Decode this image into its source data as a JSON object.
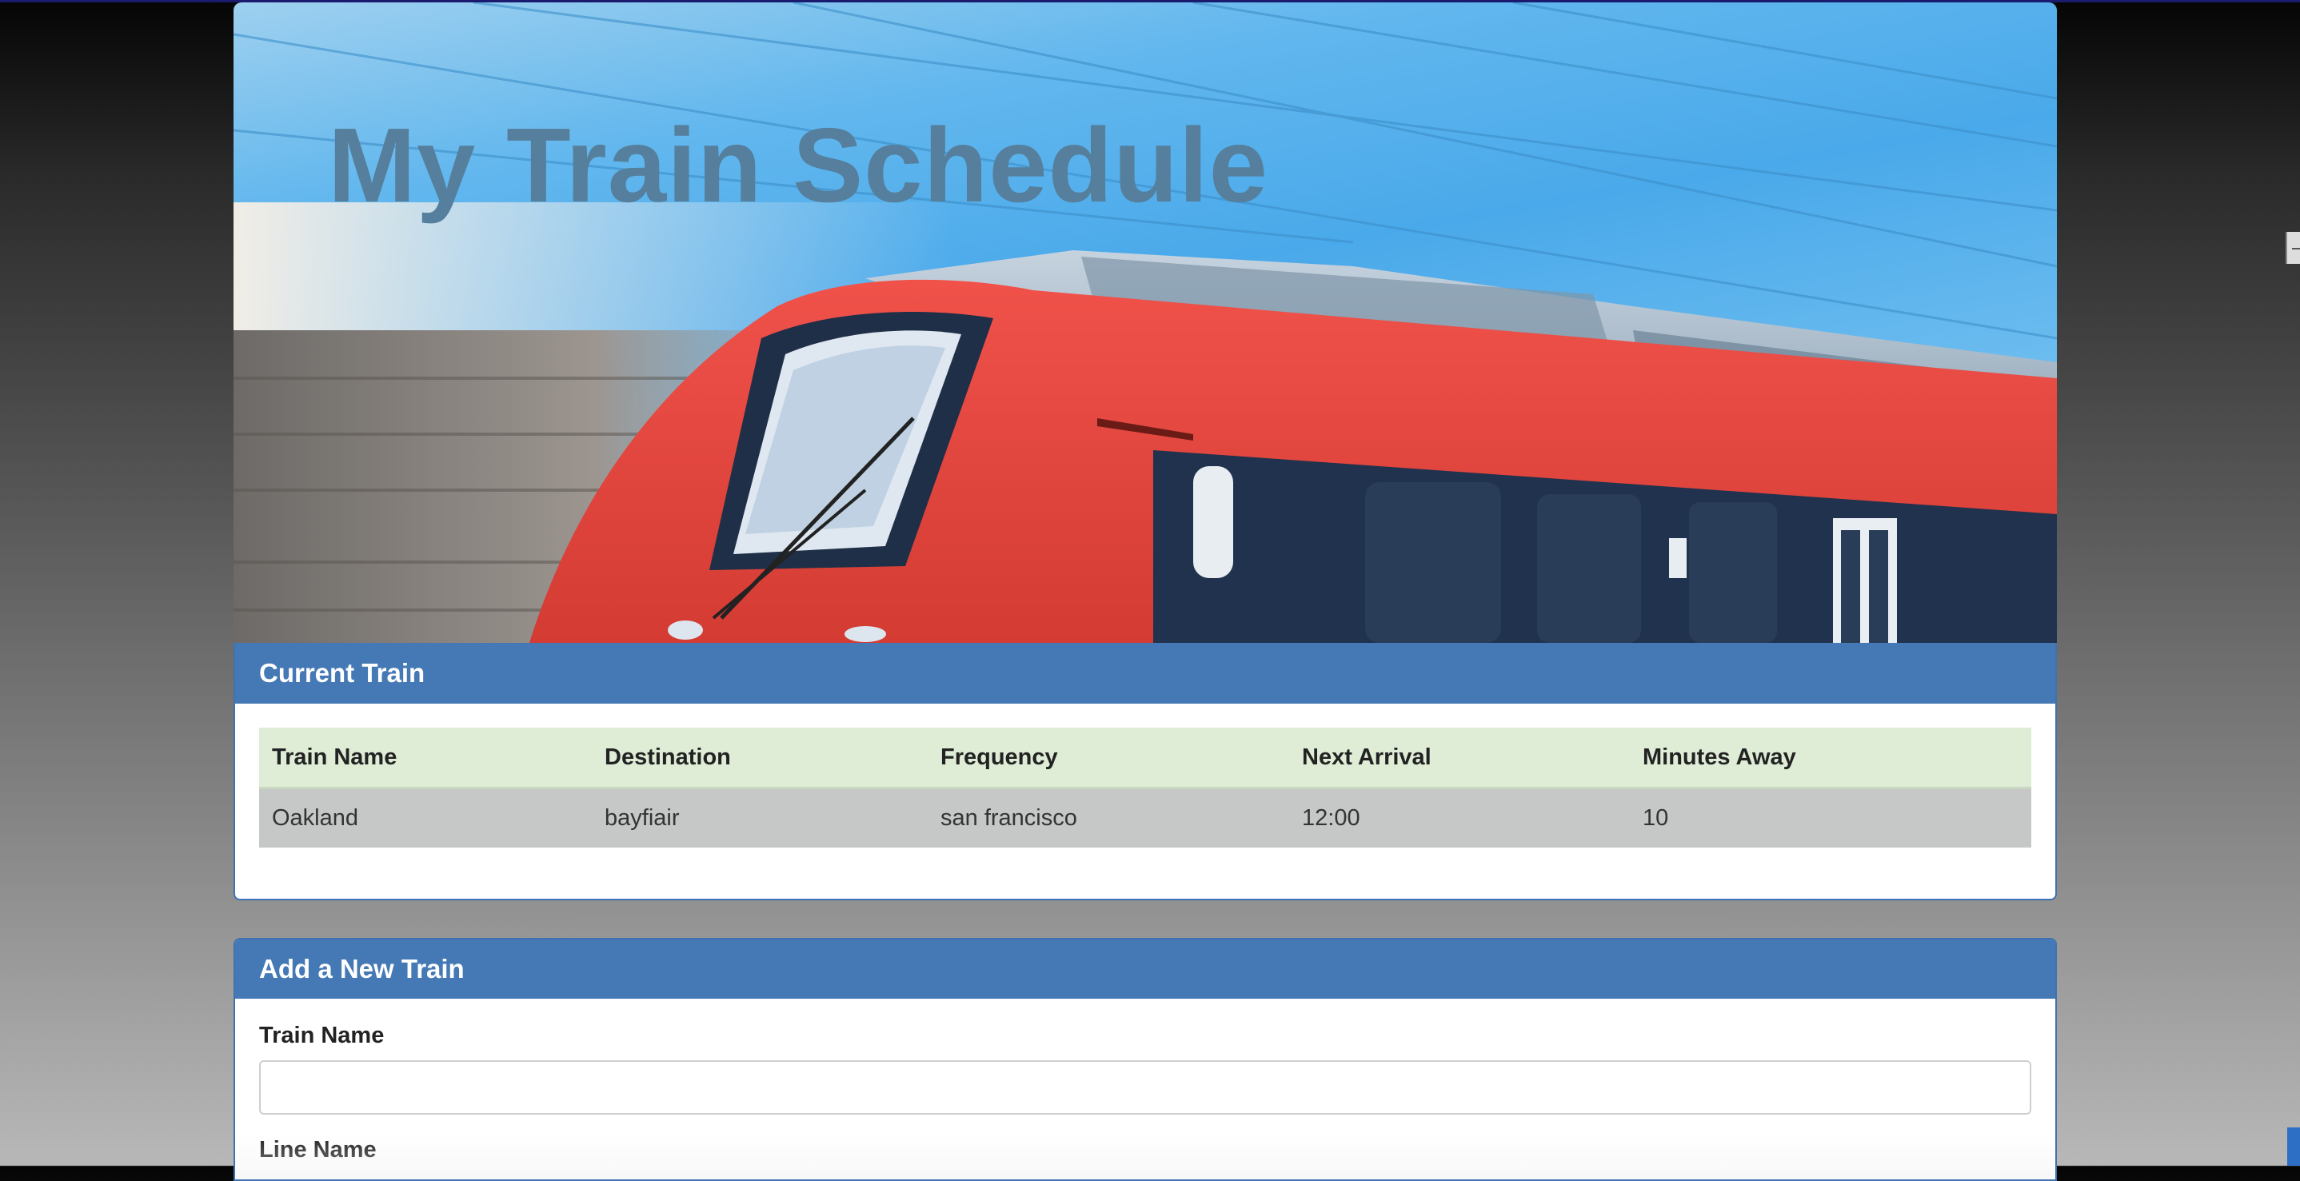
{
  "hero": {
    "title": "My Train Schedule"
  },
  "current_panel": {
    "heading": "Current Train",
    "columns": [
      "Train Name",
      "Destination",
      "Frequency",
      "Next Arrival",
      "Minutes Away"
    ],
    "rows": [
      [
        "Oakland",
        "bayfiair",
        "san francisco",
        "12:00",
        "10"
      ]
    ]
  },
  "add_panel": {
    "heading": "Add a New Train",
    "train_name_label": "Train Name",
    "train_name_value": "",
    "line_name_label": "Line Name"
  },
  "colors": {
    "panel_header": "#4579b5",
    "table_header_bg": "#dfedd7",
    "table_row_bg": "#c5c8c6",
    "hero_title": "#557f9c"
  }
}
